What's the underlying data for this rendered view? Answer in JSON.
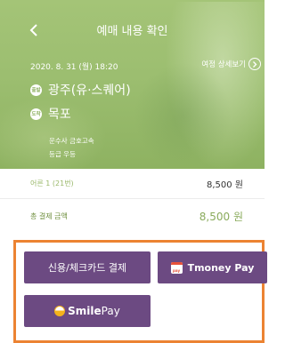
{
  "header": {
    "title": "예매 내용 확인",
    "back_icon": "chevron-left-icon"
  },
  "trip": {
    "datetime": "2020. 8. 31 (월) 18:20",
    "detail_link": "여정 상세보기",
    "departure": {
      "badge": "출발",
      "name": "광주(유·스퀘어)"
    },
    "arrival": {
      "badge": "도착",
      "name": "목포"
    },
    "company_line": "운수사 금호고속",
    "grade_line": "등급   우등"
  },
  "fare": {
    "passenger_label": "어른 1 (21번)",
    "passenger_amount": "8,500 원",
    "total_label": "총 결제 금액",
    "total_amount": "8,500 원"
  },
  "payment": {
    "card_button": "신용/체크카드 결제",
    "tmoney_logo_text": "pay",
    "tmoney_button": "Tmoney Pay",
    "smile_brand": "Smile",
    "smile_pay": "Pay"
  },
  "colors": {
    "hero": "#9cbe70",
    "pay_button": "#6c4a82",
    "highlight_border": "#ec8332",
    "total_amount": "#8aab5c"
  }
}
